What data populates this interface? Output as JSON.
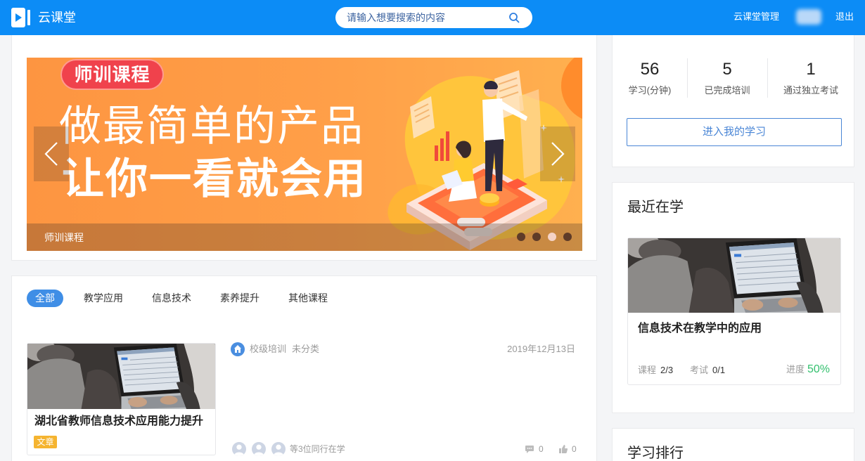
{
  "header": {
    "app_name": "云课堂",
    "search_placeholder": "请输入想要搜索的内容",
    "search_icon": "search-icon",
    "admin_link": "云课堂管理",
    "logout": "退出"
  },
  "banner": {
    "badge": "师训课程",
    "headline": "做最简单的产品",
    "subline": "让你一看就会用",
    "caption": "师训课程",
    "slide_count": 4,
    "active_slide": 3,
    "prev_icon": "chevron-left-icon",
    "next_icon": "chevron-right-icon"
  },
  "course_tabs": {
    "items": [
      "全部",
      "教学应用",
      "信息技术",
      "素养提升",
      "其他课程"
    ],
    "active": "全部"
  },
  "courses": [
    {
      "title": "湖北省教师信息技术应用能力提升",
      "tag": "文章",
      "level": "校级培训",
      "category": "未分类",
      "date": "2019年12月13日",
      "learners": "等3位同行在学",
      "comments": 0,
      "likes": 0,
      "meta_icon": "school-icon",
      "comment_icon": "comment-icon",
      "like_icon": "thumbs-up-icon"
    }
  ],
  "stats": {
    "items": [
      {
        "value": 56,
        "label": "学习(分钟)"
      },
      {
        "value": 5,
        "label": "已完成培训"
      },
      {
        "value": 1,
        "label": "通过独立考试"
      }
    ],
    "button": "进入我的学习"
  },
  "recent": {
    "title": "最近在学",
    "course": {
      "title": "信息技术在教学中的应用",
      "lessons_label": "课程",
      "lessons": "2/3",
      "exams_label": "考试",
      "exams": "0/1",
      "progress_label": "进度",
      "progress": "50%"
    }
  },
  "ranking": {
    "title": "学习排行"
  },
  "colors": {
    "brand": "#0c8cf6",
    "active_tab": "#3f8ee6",
    "tag": "#f5b430",
    "progress": "#33c06e",
    "badge": "#f0424c"
  }
}
